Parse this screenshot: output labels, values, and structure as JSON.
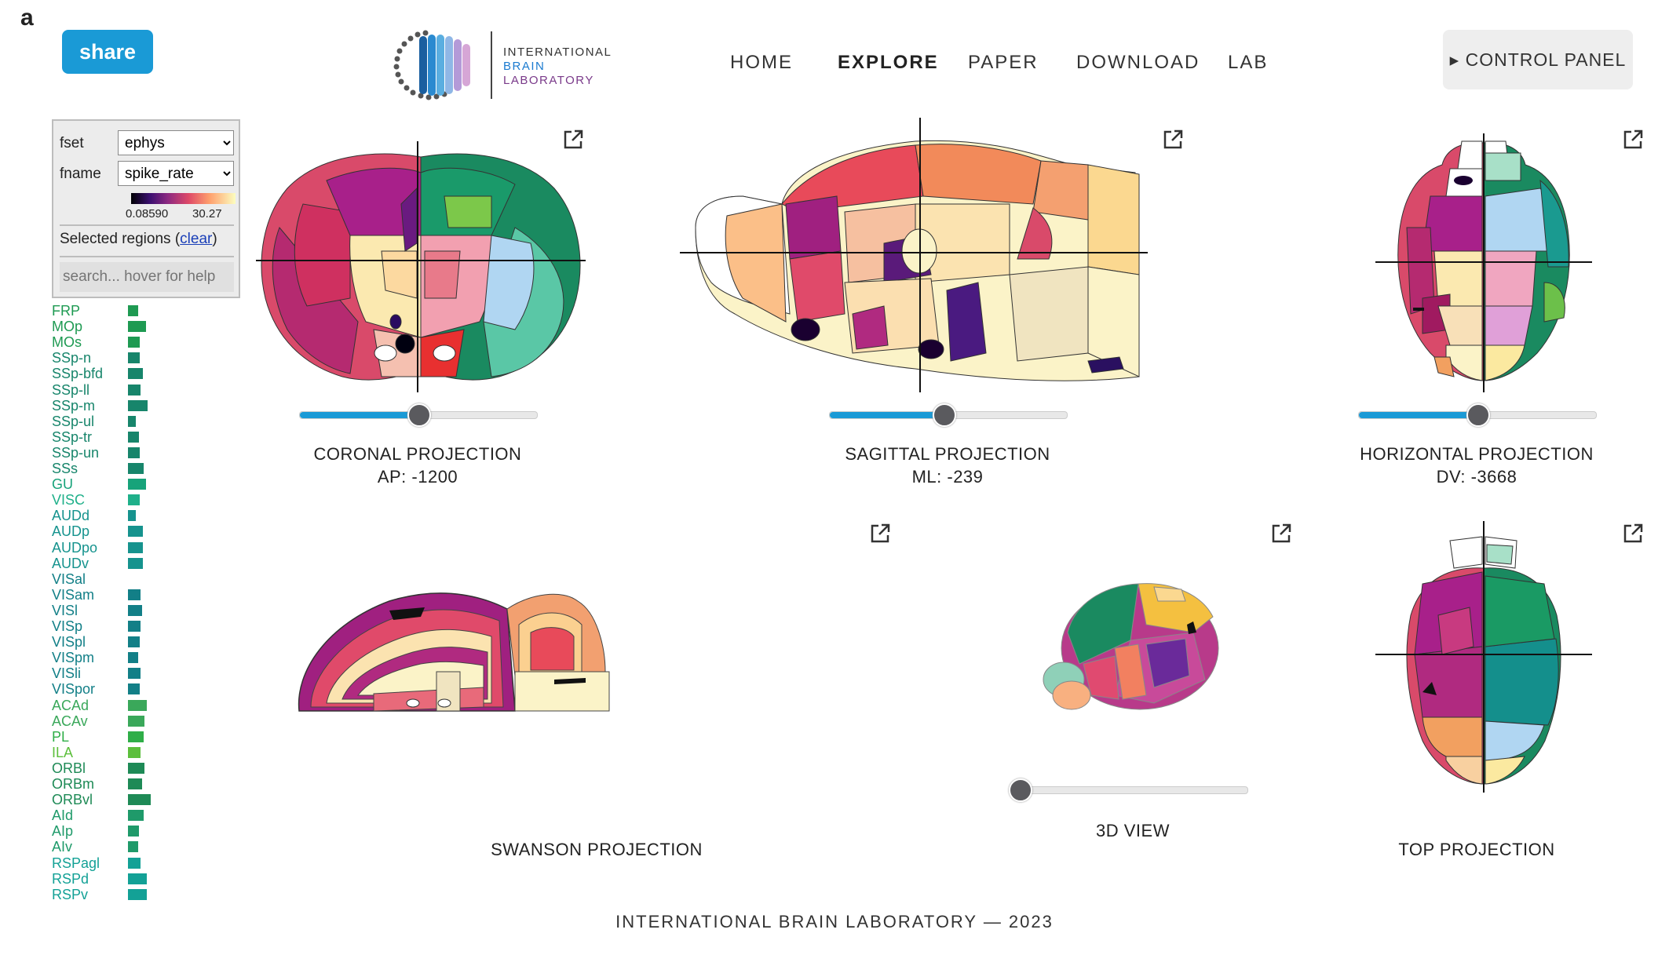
{
  "panel_letter": "a",
  "share_label": "share",
  "logo": {
    "line1": "INTERNATIONAL",
    "line2": "BRAIN",
    "line3": "LABORATORY"
  },
  "nav": [
    {
      "label": "HOME",
      "active": false
    },
    {
      "label": "EXPLORE",
      "active": true
    },
    {
      "label": "PAPER",
      "active": false
    },
    {
      "label": "DOWNLOAD",
      "active": false
    },
    {
      "label": "LAB",
      "active": false
    }
  ],
  "control_panel_label": "▸ CONTROL PANEL",
  "features": {
    "fset_label": "fset",
    "fset_value": "ephys",
    "fname_label": "fname",
    "fname_value": "spike_rate",
    "colorbar_min": "0.08590",
    "colorbar_max": "30.27",
    "selected_regions_prefix": "Selected regions (",
    "clear_label": "clear",
    "selected_regions_suffix": ")",
    "search_placeholder": "search... hover for help"
  },
  "regions": [
    {
      "name": "FRP",
      "value": 0.25,
      "color": "#1e9a52"
    },
    {
      "name": "MOp",
      "value": 0.45,
      "color": "#1e9a52"
    },
    {
      "name": "MOs",
      "value": 0.3,
      "color": "#1e9a52"
    },
    {
      "name": "SSp-n",
      "value": 0.3,
      "color": "#17856b"
    },
    {
      "name": "SSp-bfd",
      "value": 0.38,
      "color": "#17856b"
    },
    {
      "name": "SSp-ll",
      "value": 0.32,
      "color": "#17856b"
    },
    {
      "name": "SSp-m",
      "value": 0.5,
      "color": "#17856b"
    },
    {
      "name": "SSp-ul",
      "value": 0.2,
      "color": "#17856b"
    },
    {
      "name": "SSp-tr",
      "value": 0.28,
      "color": "#17856b"
    },
    {
      "name": "SSp-un",
      "value": 0.3,
      "color": "#17856b"
    },
    {
      "name": "SSs",
      "value": 0.4,
      "color": "#17856b"
    },
    {
      "name": "GU",
      "value": 0.45,
      "color": "#17a37a"
    },
    {
      "name": "VISC",
      "value": 0.3,
      "color": "#1fb08a"
    },
    {
      "name": "AUDd",
      "value": 0.2,
      "color": "#16938e"
    },
    {
      "name": "AUDp",
      "value": 0.38,
      "color": "#16938e"
    },
    {
      "name": "AUDpo",
      "value": 0.38,
      "color": "#16938e"
    },
    {
      "name": "AUDv",
      "value": 0.38,
      "color": "#16938e"
    },
    {
      "name": "VISal",
      "value": 0,
      "color": "#127f87"
    },
    {
      "name": "VISam",
      "value": 0.32,
      "color": "#127f87"
    },
    {
      "name": "VISl",
      "value": 0.35,
      "color": "#127f87"
    },
    {
      "name": "VISp",
      "value": 0.32,
      "color": "#127f87"
    },
    {
      "name": "VISpl",
      "value": 0.3,
      "color": "#127f87"
    },
    {
      "name": "VISpm",
      "value": 0.25,
      "color": "#127f87"
    },
    {
      "name": "VISli",
      "value": 0.32,
      "color": "#127f87"
    },
    {
      "name": "VISpor",
      "value": 0.3,
      "color": "#127f87"
    },
    {
      "name": "ACAd",
      "value": 0.48,
      "color": "#3aa85a"
    },
    {
      "name": "ACAv",
      "value": 0.42,
      "color": "#3aa85a"
    },
    {
      "name": "PL",
      "value": 0.4,
      "color": "#2fae48"
    },
    {
      "name": "ILA",
      "value": 0.32,
      "color": "#5cbf3c"
    },
    {
      "name": "ORBl",
      "value": 0.42,
      "color": "#1e8a56"
    },
    {
      "name": "ORBm",
      "value": 0.35,
      "color": "#1e8a56"
    },
    {
      "name": "ORBvl",
      "value": 0.58,
      "color": "#1e8a56"
    },
    {
      "name": "AId",
      "value": 0.4,
      "color": "#1f9a6a"
    },
    {
      "name": "AIp",
      "value": 0.28,
      "color": "#1f9a6a"
    },
    {
      "name": "AIv",
      "value": 0.25,
      "color": "#1f9a6a"
    },
    {
      "name": "RSPagl",
      "value": 0.32,
      "color": "#13a196"
    },
    {
      "name": "RSPd",
      "value": 0.48,
      "color": "#13a196"
    },
    {
      "name": "RSPv",
      "value": 0.48,
      "color": "#13a196"
    }
  ],
  "views": {
    "coronal": {
      "title": "CORONAL PROJECTION",
      "subtitle": "AP: -1200",
      "slider": 0.5
    },
    "sagittal": {
      "title": "SAGITTAL PROJECTION",
      "subtitle": "ML: -239",
      "slider": 0.48
    },
    "horizontal": {
      "title": "HORIZONTAL PROJECTION",
      "subtitle": "DV: -3668",
      "slider": 0.5
    },
    "swanson": {
      "title": "SWANSON PROJECTION"
    },
    "three_d": {
      "title": "3D VIEW",
      "slider": 0.0
    },
    "top": {
      "title": "TOP PROJECTION"
    }
  },
  "footer": "INTERNATIONAL BRAIN LABORATORY — 2023"
}
